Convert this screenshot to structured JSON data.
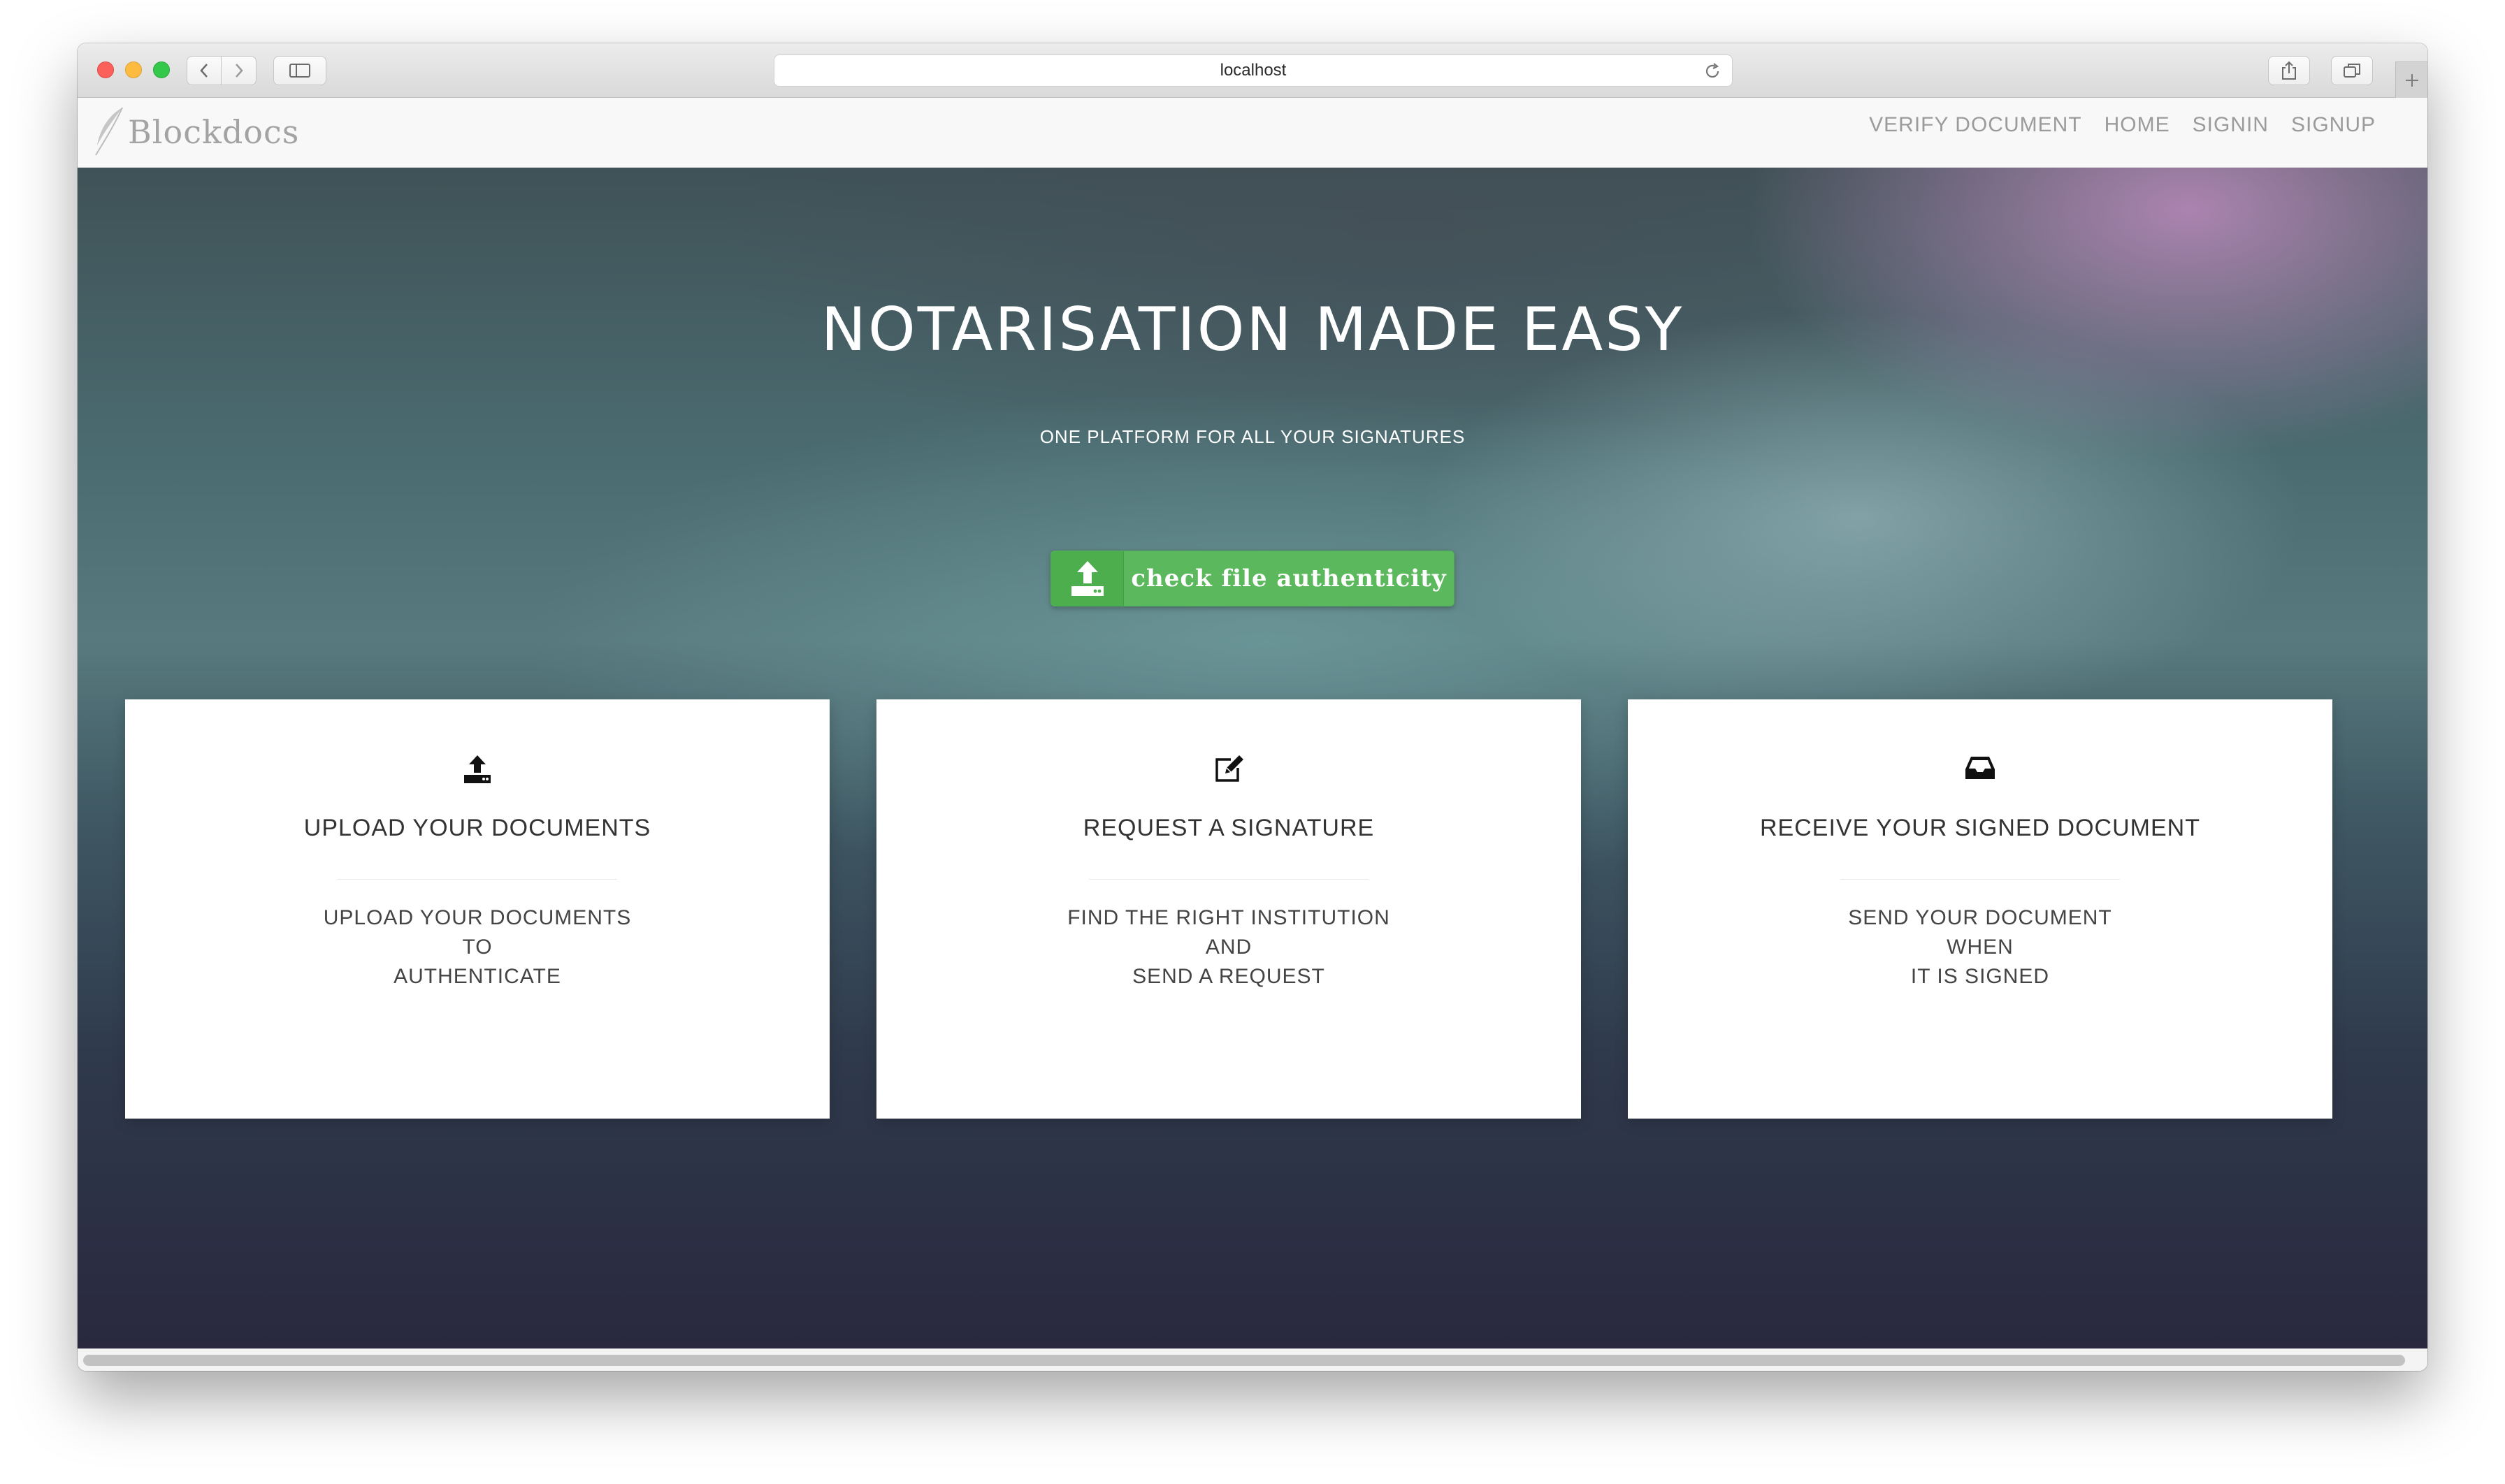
{
  "browser": {
    "url": "localhost",
    "icons": {
      "back": "chevron-left-icon",
      "forward": "chevron-right-icon",
      "sidebar": "sidebar-icon",
      "reload": "reload-icon",
      "share": "share-icon",
      "tabs": "tabs-overview-icon",
      "new_tab": "plus-icon"
    }
  },
  "navbar": {
    "brand": "Blockdocs",
    "links": [
      {
        "label": "VERIFY DOCUMENT"
      },
      {
        "label": "HOME"
      },
      {
        "label": "SIGNIN"
      },
      {
        "label": "SIGNUP"
      }
    ]
  },
  "hero": {
    "title": "NOTARISATION MADE EASY",
    "subtitle": "ONE PLATFORM FOR ALL YOUR SIGNATURES",
    "cta": {
      "label": "check file authenticity",
      "icon": "upload-icon",
      "color": "#5cb85c"
    }
  },
  "cards": [
    {
      "icon": "upload-icon",
      "title": "UPLOAD YOUR DOCUMENTS",
      "lines": [
        "UPLOAD YOUR DOCUMENTS",
        "TO",
        "AUTHENTICATE"
      ]
    },
    {
      "icon": "edit-icon",
      "title": "REQUEST A SIGNATURE",
      "lines": [
        "FIND THE RIGHT INSTITUTION",
        "AND",
        "SEND A REQUEST"
      ]
    },
    {
      "icon": "inbox-icon",
      "title": "RECEIVE YOUR SIGNED DOCUMENT",
      "lines": [
        "SEND YOUR DOCUMENT",
        "WHEN",
        "IT IS SIGNED"
      ]
    }
  ]
}
